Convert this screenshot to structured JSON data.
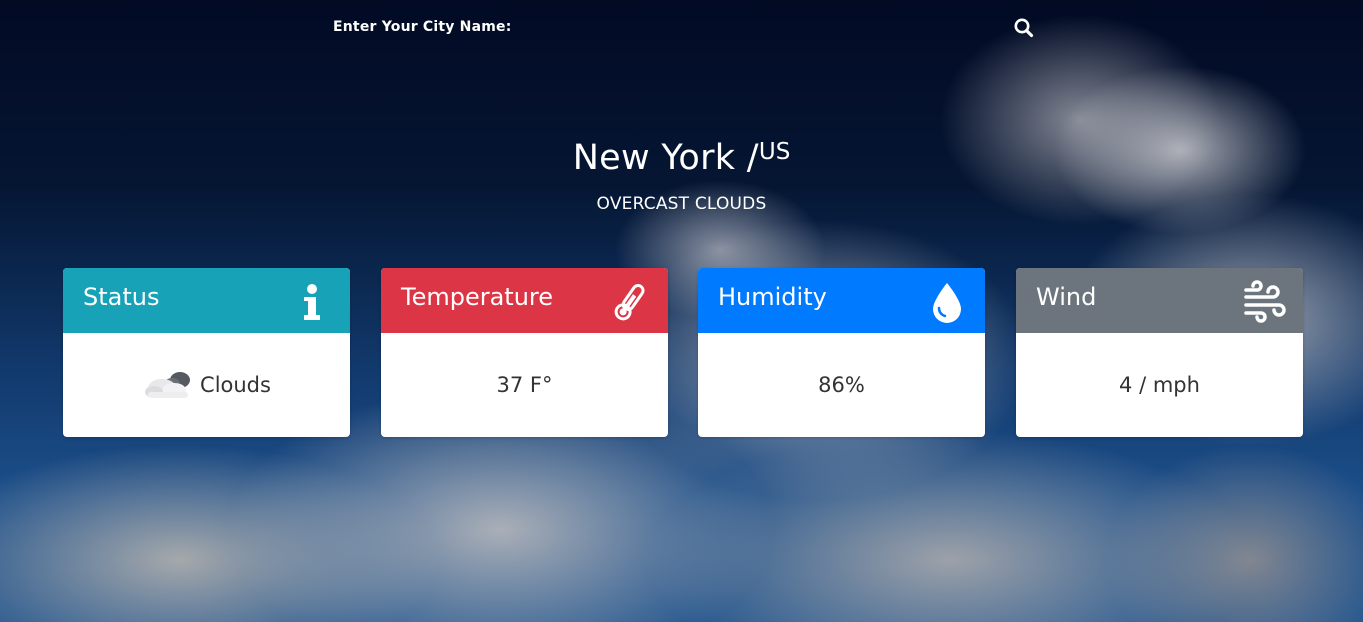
{
  "search": {
    "label": "Enter Your City Name:",
    "value": "",
    "placeholder": ""
  },
  "location": {
    "city": "New York /",
    "country": "US",
    "description": "OVERCAST CLOUDS"
  },
  "cards": {
    "status": {
      "title": "Status",
      "value": "Clouds",
      "color": "#17a2b8",
      "icon": "info-icon",
      "value_icon": "clouds-icon"
    },
    "temperature": {
      "title": "Temperature",
      "value": "37 F°",
      "color": "#dc3545",
      "icon": "thermometer-icon"
    },
    "humidity": {
      "title": "Humidity",
      "value": "86%",
      "color": "#007bff",
      "icon": "droplet-icon"
    },
    "wind": {
      "title": "Wind",
      "value": "4 / mph",
      "color": "#6c757d",
      "icon": "wind-icon"
    }
  }
}
